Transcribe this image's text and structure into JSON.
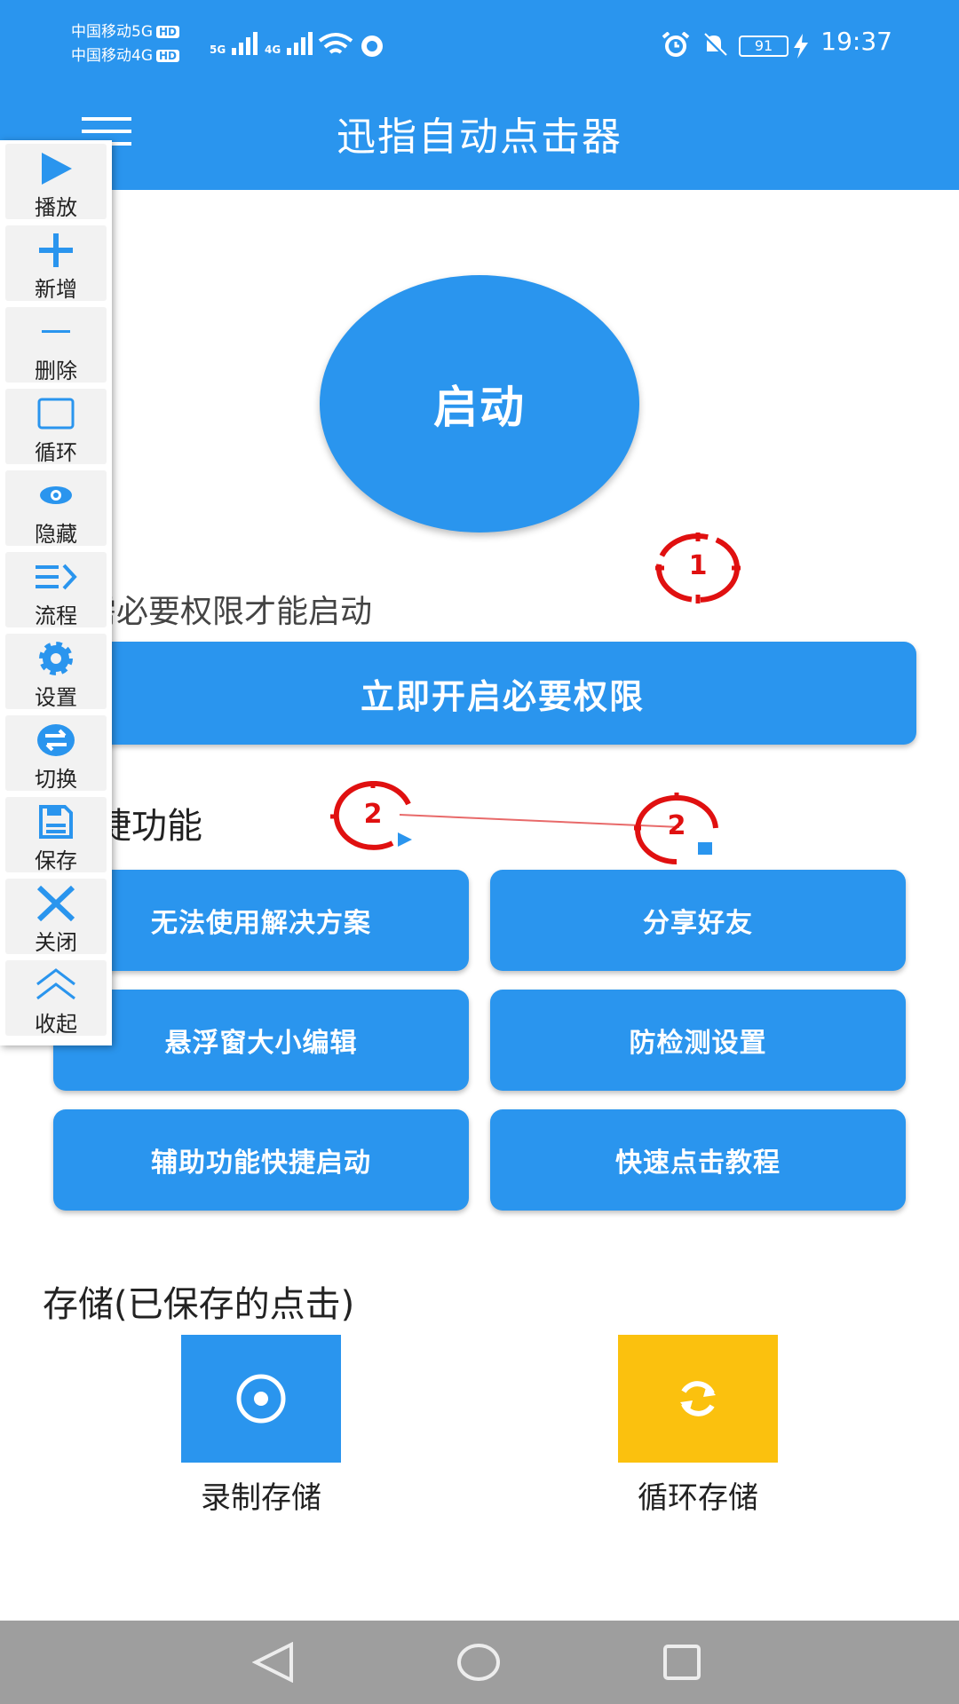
{
  "status_bar": {
    "carrier1": "中国移动5G",
    "carrier2": "中国移动4G",
    "hd": "HD",
    "sig1": "5G",
    "sig2": "4G",
    "battery": "91",
    "time": "19:37"
  },
  "header": {
    "title": "迅指自动点击器",
    "menu_icon": "menu-icon"
  },
  "main": {
    "start_label": "启动",
    "permission_hint": "需必要权限才能启动",
    "permission_button": "立即开启必要权限",
    "quick_title": "捷功能",
    "quick_buttons": [
      {
        "label": "无法使用解决方案"
      },
      {
        "label": "分享好友"
      },
      {
        "label": "悬浮窗大小编辑"
      },
      {
        "label": "防检测设置"
      },
      {
        "label": "辅助功能快捷启动"
      },
      {
        "label": "快速点击教程"
      }
    ],
    "storage_title": "存储(已保存的点击)",
    "storage_items": [
      {
        "label": "录制存储",
        "icon": "record-icon",
        "color": "#2a95ee"
      },
      {
        "label": "循环存储",
        "icon": "loop-icon",
        "color": "#fbc10e"
      }
    ]
  },
  "toolbar": {
    "items": [
      {
        "label": "播放",
        "icon": "play-icon"
      },
      {
        "label": "新增",
        "icon": "plus-icon"
      },
      {
        "label": "删除",
        "icon": "minus-icon"
      },
      {
        "label": "循环",
        "icon": "square-icon"
      },
      {
        "label": "隐藏",
        "icon": "eye-icon"
      },
      {
        "label": "流程",
        "icon": "flow-icon"
      },
      {
        "label": "设置",
        "icon": "gear-icon"
      },
      {
        "label": "切换",
        "icon": "switch-icon"
      },
      {
        "label": "保存",
        "icon": "save-icon"
      },
      {
        "label": "关闭",
        "icon": "close-icon"
      },
      {
        "label": "收起",
        "icon": "collapse-icon"
      }
    ]
  },
  "markers": [
    {
      "label": "1"
    },
    {
      "label": "2"
    },
    {
      "label": "2"
    }
  ],
  "colors": {
    "accent": "#2a95ee",
    "yellow": "#fbc10e",
    "marker_red": "#e01010",
    "navbar": "#9e9e9e"
  }
}
